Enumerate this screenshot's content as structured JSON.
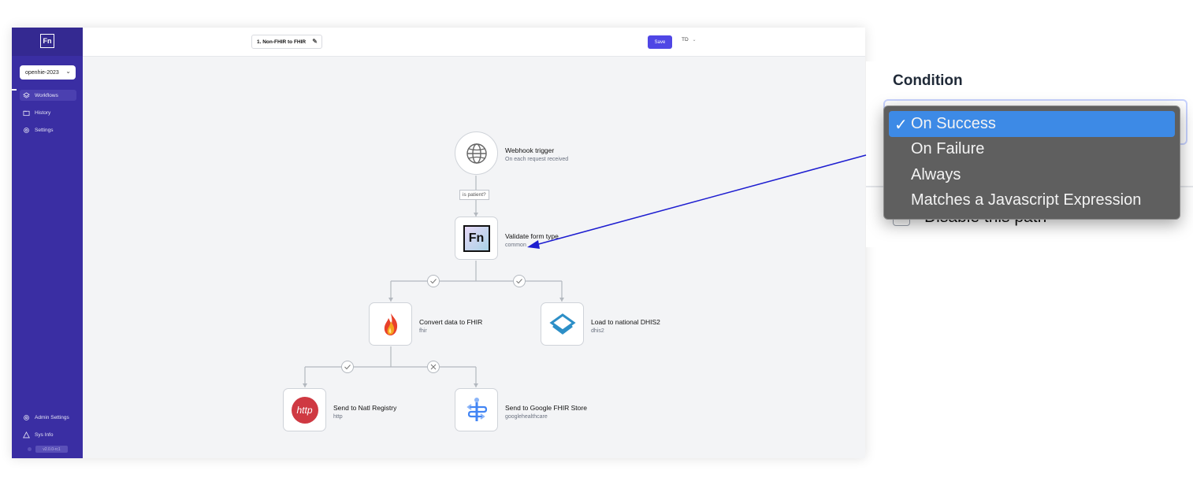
{
  "sidebar": {
    "logo": "Fn",
    "project": "openhie-2023",
    "nav": [
      {
        "label": "Workflows",
        "icon": "layers-icon",
        "active": true
      },
      {
        "label": "History",
        "icon": "folder-icon"
      },
      {
        "label": "Settings",
        "icon": "gear-icon"
      }
    ],
    "bottom_nav": [
      {
        "label": "Admin Settings",
        "icon": "gear-icon"
      },
      {
        "label": "Sys Info",
        "icon": "warning-triangle-icon"
      }
    ],
    "version": "v2.0.0-rc1"
  },
  "topbar": {
    "workflow_name": "1. Non-FHIR to FHIR",
    "save_label": "Save",
    "user_initials": "TD"
  },
  "workflow": {
    "trigger": {
      "title": "Webhook trigger",
      "subtitle": "On each request received"
    },
    "trigger_edge_label": "is patient?",
    "jobs": [
      {
        "title": "Validate form type",
        "adaptor": "common"
      },
      {
        "title": "Convert data to FHIR",
        "adaptor": "fhir"
      },
      {
        "title": "Load to national DHIS2",
        "adaptor": "dhis2"
      },
      {
        "title": "Send to Natl Registry",
        "adaptor": "http"
      },
      {
        "title": "Send to Google FHIR Store",
        "adaptor": "googlehealthcare"
      }
    ],
    "icons": {
      "fn_logo": "Fn",
      "http": "http"
    }
  },
  "condition_panel": {
    "title": "Condition",
    "disable_label": "Disable this path",
    "options": [
      {
        "label": "On Success",
        "selected": true
      },
      {
        "label": "On Failure",
        "selected": false
      },
      {
        "label": "Always",
        "selected": false
      },
      {
        "label": "Matches a Javascript Expression",
        "selected": false
      }
    ],
    "check_mark": "✓"
  },
  "colors": {
    "sidebar": "#3a2ea3",
    "primary": "#4f46e5",
    "selected_option": "#3d8ae6",
    "annotation_arrow": "#1d1dd0"
  }
}
